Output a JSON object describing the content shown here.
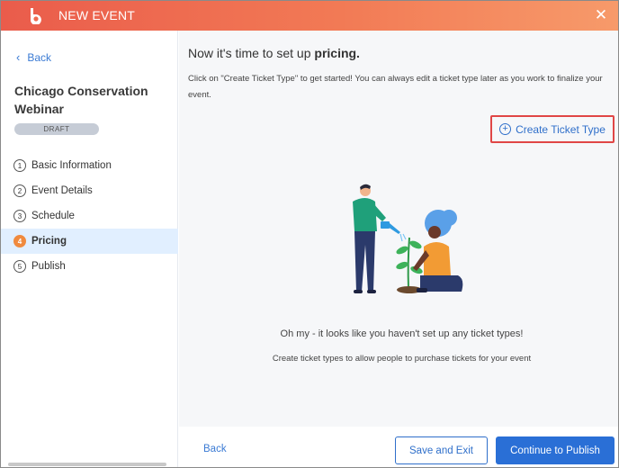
{
  "header": {
    "title": "NEW EVENT",
    "logo_icon": "b-logo-icon",
    "close_glyph": "✕"
  },
  "sidebar": {
    "back_label": "Back",
    "event_title": "Chicago Conservation Webinar",
    "status": "DRAFT",
    "steps": [
      {
        "num": "1",
        "label": "Basic Information",
        "active": false
      },
      {
        "num": "2",
        "label": "Event Details",
        "active": false
      },
      {
        "num": "3",
        "label": "Schedule",
        "active": false
      },
      {
        "num": "4",
        "label": "Pricing",
        "active": true
      },
      {
        "num": "5",
        "label": "Publish",
        "active": false
      }
    ]
  },
  "main": {
    "heading_prefix": "Now it's time to set up ",
    "heading_bold": "pricing.",
    "description": "Click on \"Create Ticket Type\" to get started! You can always edit a ticket type later as you work to finalize your event.",
    "create_button_label": "Create Ticket Type",
    "empty_title": "Oh my - it looks like you haven't set up any ticket types!",
    "empty_subtitle": "Create ticket types to allow people to purchase tickets for your event"
  },
  "footer": {
    "back_label": "Back",
    "save_label": "Save and Exit",
    "continue_label": "Continue to Publish"
  },
  "colors": {
    "header_start": "#ea5c4b",
    "header_end": "#f79a6a",
    "link_blue": "#3b7bd4",
    "primary_button": "#2a6fd6",
    "active_step_bg": "#e1efff",
    "active_step_accent": "#f08a3e",
    "highlight_border": "#e04646"
  }
}
